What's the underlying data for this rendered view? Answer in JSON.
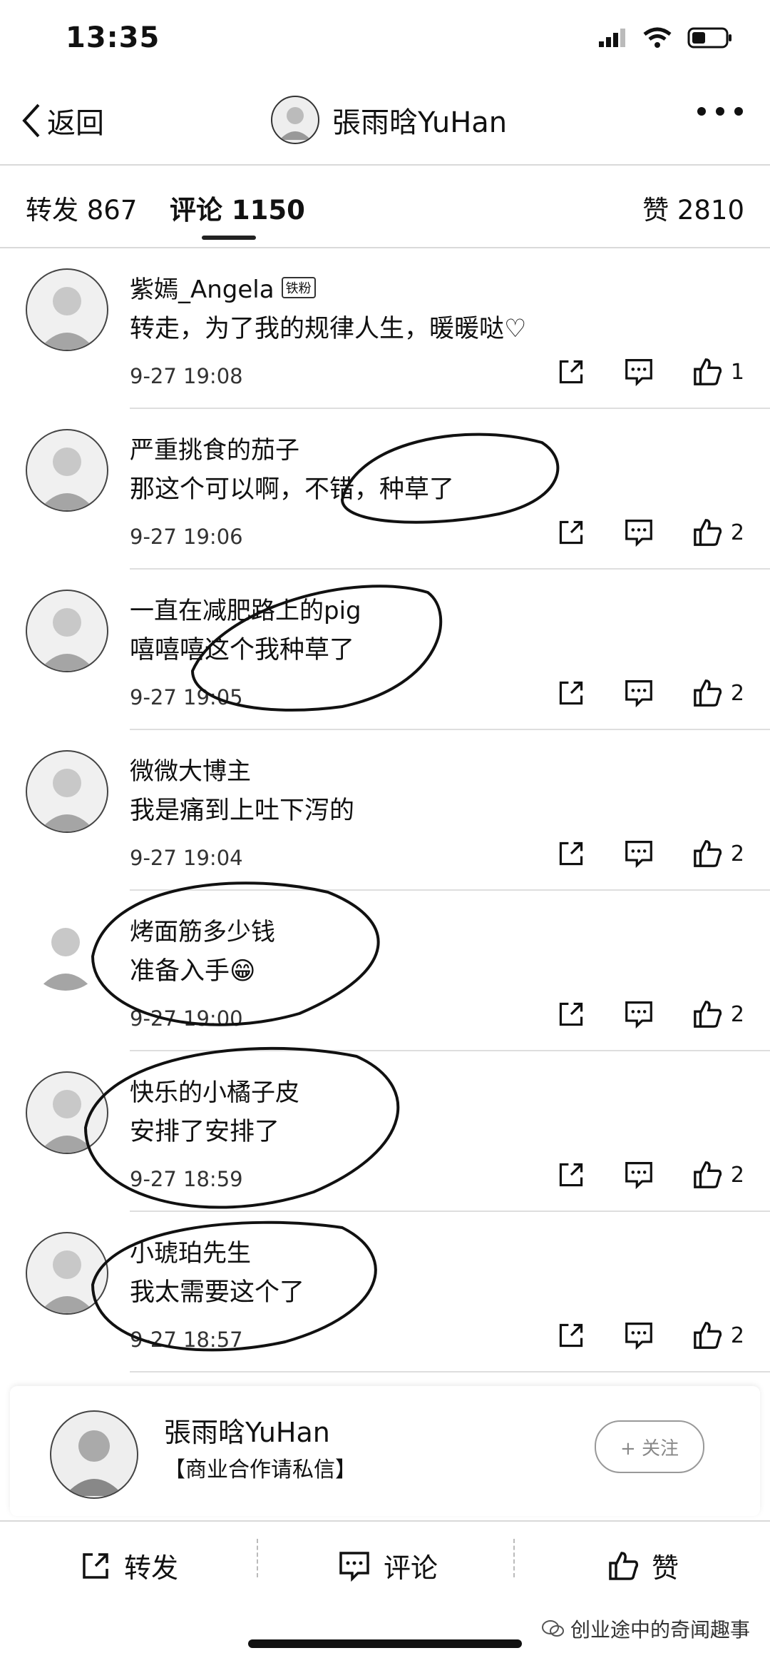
{
  "status_bar": {
    "time": "13:35"
  },
  "nav": {
    "back_label": "返回",
    "title": "張雨晗YuHan"
  },
  "tabs": {
    "repost": "转发 867",
    "comments": "评论 1150",
    "likes": "赞 2810"
  },
  "comments": [
    {
      "name": "紫嫣_Angela",
      "badge": "铁粉",
      "text": "转走，为了我的规律人生，暖暖哒♡",
      "time": "9-27 19:08",
      "likes": "1"
    },
    {
      "name": "严重挑食的茄子",
      "text": "那这个可以啊，不错，种草了",
      "time": "9-27 19:06",
      "likes": "2"
    },
    {
      "name": "一直在减肥路上的pig",
      "text": "嘻嘻嘻这个我种草了",
      "time": "9-27 19:05",
      "likes": "2"
    },
    {
      "name": "微微大博主",
      "text": "我是痛到上吐下泻的",
      "time": "9-27 19:04",
      "likes": "2"
    },
    {
      "name": "烤面筋多少钱",
      "text": "准备入手😁",
      "time": "9-27 19:00",
      "likes": "2"
    },
    {
      "name": "快乐的小橘子皮",
      "text": "安排了安排了",
      "time": "9-27 18:59",
      "likes": "2"
    },
    {
      "name": "小琥珀先生",
      "text": "我太需要这个了",
      "time": "9-27 18:57",
      "likes": "2"
    }
  ],
  "card": {
    "name": "張雨晗YuHan",
    "description": "【商业合作请私信】",
    "follow_label": "+ 关注"
  },
  "bottom_bar": {
    "repost": "转发",
    "comment": "评论",
    "like": "赞"
  },
  "watermark": "创业途中的奇闻趣事"
}
